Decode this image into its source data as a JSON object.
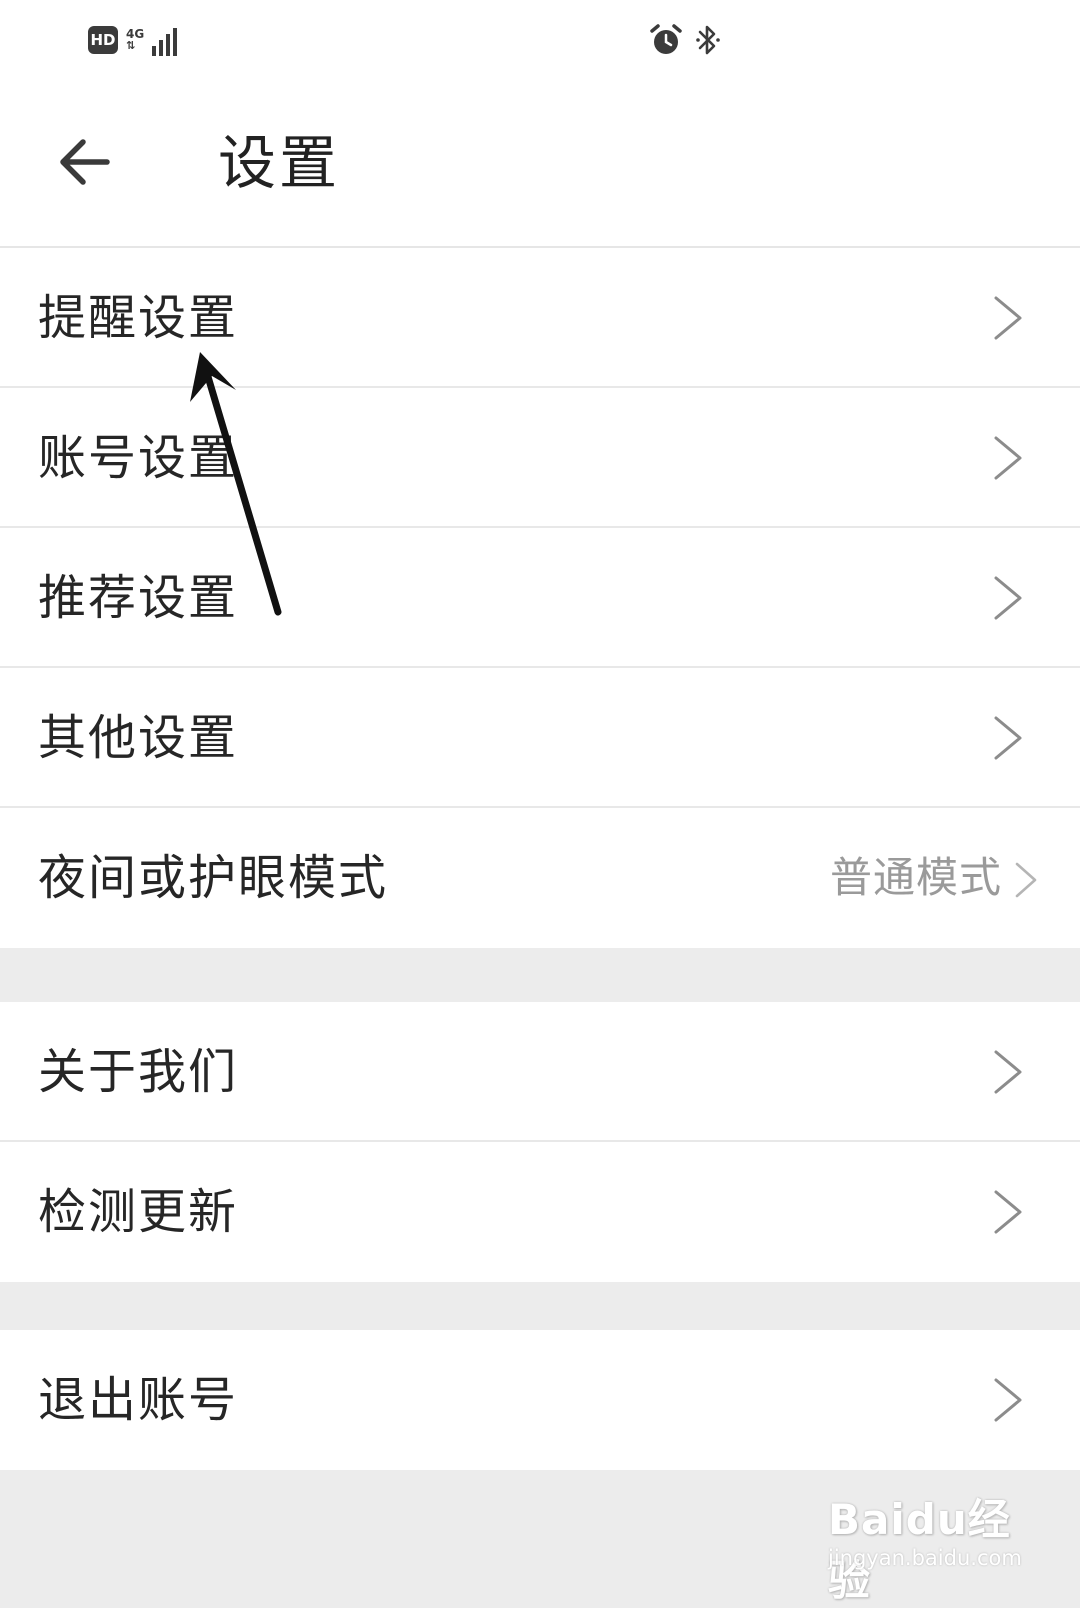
{
  "status_bar": {
    "hd_label": "HD",
    "network_label": "4G",
    "icons": [
      "hd-badge",
      "signal-icon",
      "alarm-icon",
      "bluetooth-icon"
    ]
  },
  "header": {
    "title": "设置",
    "back_icon": "back-arrow-icon"
  },
  "groups": [
    {
      "items": [
        {
          "label": "提醒设置",
          "value": ""
        },
        {
          "label": "账号设置",
          "value": ""
        },
        {
          "label": "推荐设置",
          "value": ""
        },
        {
          "label": "其他设置",
          "value": ""
        },
        {
          "label": "夜间或护眼模式",
          "value": "普通模式"
        }
      ]
    },
    {
      "items": [
        {
          "label": "关于我们",
          "value": ""
        },
        {
          "label": "检测更新",
          "value": ""
        }
      ]
    },
    {
      "items": [
        {
          "label": "退出账号",
          "value": ""
        }
      ]
    }
  ],
  "watermark": {
    "brand": "Baidu经验",
    "url": "jingyan.baidu.com"
  },
  "colors": {
    "background": "#ececec",
    "surface": "#ffffff",
    "text": "#262626",
    "secondary_text": "#9a9a9a",
    "chevron": "#8c8c8c",
    "annotation_arrow": "#111111"
  }
}
